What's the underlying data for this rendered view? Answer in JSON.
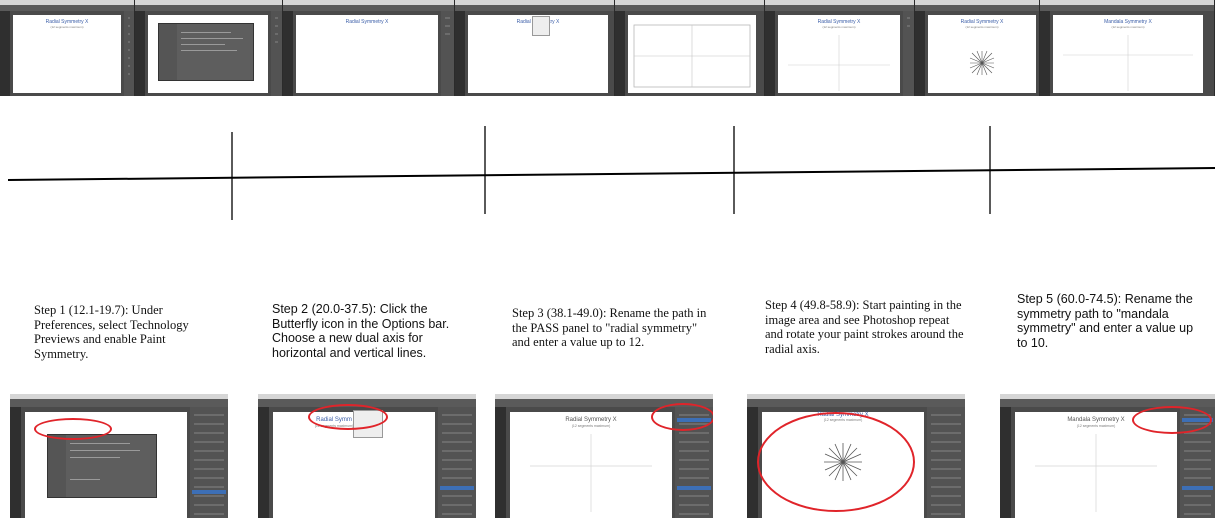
{
  "filmstrip": {
    "frames": [
      {
        "canvas_title": "Radial Symmetry X",
        "canvas_subtitle": "(12 segments maximum)"
      },
      {
        "canvas_title": "",
        "canvas_subtitle": ""
      },
      {
        "canvas_title": "Radial Symmetry X",
        "canvas_subtitle": ""
      },
      {
        "canvas_title": "Radial Symmetry X",
        "canvas_subtitle": ""
      },
      {
        "canvas_title": "",
        "canvas_subtitle": ""
      },
      {
        "canvas_title": "Radial Symmetry X",
        "canvas_subtitle": "(12 segments maximum)"
      },
      {
        "canvas_title": "Radial Symmetry X",
        "canvas_subtitle": "(12 segments maximum)"
      },
      {
        "canvas_title": "Radial Symmetry X",
        "canvas_subtitle": "(12 segments maximum)"
      },
      {
        "canvas_title": "Mandala Symmetry X",
        "canvas_subtitle": "(12 segments maximum)"
      }
    ]
  },
  "steps": [
    {
      "text": "Step 1 (12.1-19.7): Under Preferences, select Technology Previews and enable Paint Symmetry."
    },
    {
      "text": "Step 2 (20.0-37.5): Click the Butterfly icon in the Options bar. Choose a new dual axis for horizontal and vertical lines."
    },
    {
      "text": "Step 3 (38.1-49.0): Rename the path in the PASS panel to \"radial symmetry\" and enter a value up to 12."
    },
    {
      "text": "Step 4 (49.8-58.9): Start painting in the image area and see Photoshop repeat and rotate your paint strokes around the radial axis."
    },
    {
      "text": "Step 5 (60.0-74.5): Rename the symmetry path to \"mandala symmetry\" and enter a value up to 10."
    }
  ],
  "thumbnails": [
    {
      "canvas_title": "",
      "canvas_subtitle": ""
    },
    {
      "canvas_title": "Radial Symm",
      "canvas_subtitle": "(12 segments maximum)"
    },
    {
      "canvas_title": "Radial Symmetry X",
      "canvas_subtitle": "(12 segments maximum)"
    },
    {
      "canvas_title": "Radial Symmetry X",
      "canvas_subtitle": "(12 segments maximum)"
    },
    {
      "canvas_title": "Mandala Symmetry X",
      "canvas_subtitle": "(12 segments maximum)"
    }
  ],
  "colors": {
    "highlight": "#e0242a",
    "title_blue": "#3b5ea8",
    "app_dark": "#4a4a4a"
  }
}
